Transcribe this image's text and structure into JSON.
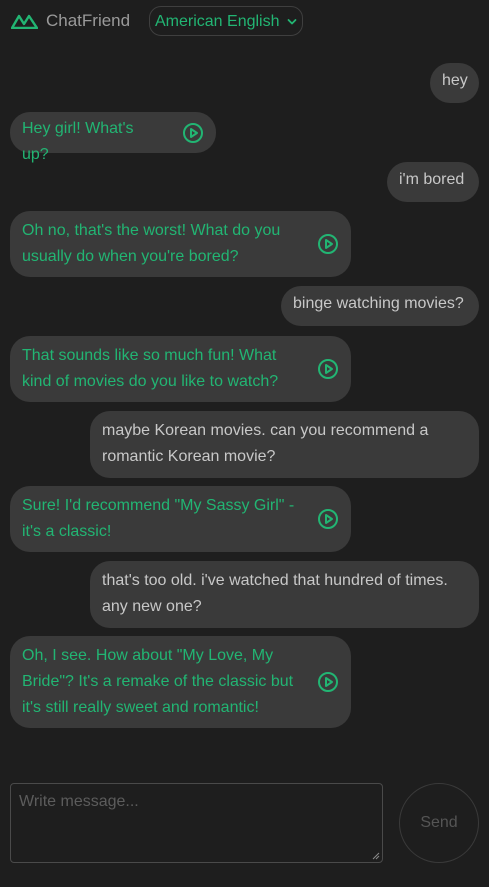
{
  "header": {
    "app_title": "ChatFriend",
    "language": "American English",
    "logo_icon": "chatfriend-logo",
    "accent_color": "#22b573"
  },
  "messages": [
    {
      "role": "user",
      "text": "hey"
    },
    {
      "role": "bot",
      "text": "Hey girl! What's up?"
    },
    {
      "role": "user",
      "text": "i'm bored"
    },
    {
      "role": "bot",
      "text": "Oh no, that's the worst! What do you usually do when you're bored?"
    },
    {
      "role": "user",
      "text": "binge watching movies?"
    },
    {
      "role": "bot",
      "text": "That sounds like so much fun! What kind of movies do you like to watch?"
    },
    {
      "role": "user",
      "text": "maybe Korean movies. can you recommend a romantic Korean movie?"
    },
    {
      "role": "bot",
      "text": "Sure! I'd recommend \"My Sassy Girl\" - it's a classic!"
    },
    {
      "role": "user",
      "text": "that's too old. i've watched that hundred of times. any new one?"
    },
    {
      "role": "bot",
      "text": "Oh, I see. How about \"My Love, My Bride\"? It's a remake of the classic but it's still really sweet and romantic!"
    }
  ],
  "composer": {
    "placeholder": "Write message...",
    "value": "",
    "send_label": "Send"
  }
}
